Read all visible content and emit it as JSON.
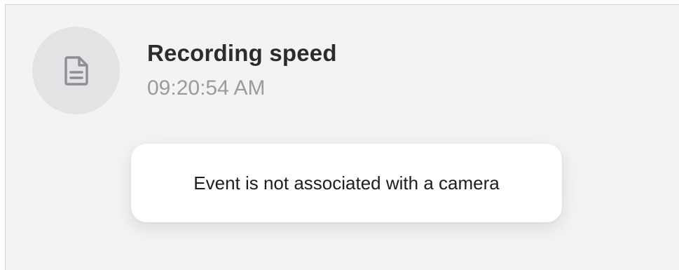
{
  "event": {
    "icon": "document-icon",
    "title": "Recording speed",
    "time": "09:20:54 AM"
  },
  "toast": {
    "message": "Event is not associated with a camera"
  },
  "colors": {
    "panel_background": "#f3f3f4",
    "avatar_background": "#e3e3e6",
    "icon": "#8e8e93",
    "title_text": "#2c2c2e",
    "time_text": "#9a9aa0",
    "toast_background": "#ffffff"
  }
}
